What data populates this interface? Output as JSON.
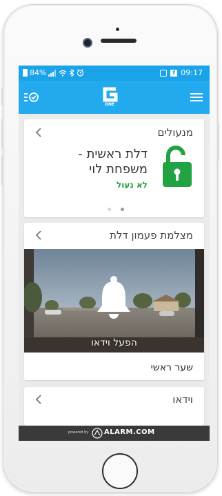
{
  "status_bar": {
    "battery": "84%",
    "time": "09:17",
    "fb_glyph": "f"
  },
  "app_bar": {
    "logo_text": "ONE",
    "left_icon": "check-list-icon",
    "right_icon": "hamburger-menu-icon"
  },
  "locks_card": {
    "title": "מנעולים",
    "lock_name_line1": "דלת ראשית -",
    "lock_name_line2": "משפחת לוי",
    "lock_status": "לא נעול",
    "lock_icon_color": "#23a244",
    "status_color": "#1e9e3e"
  },
  "doorbell_card": {
    "title": "מצלמת פעמון דלת",
    "play_label": "הפעל וידאו",
    "camera_name": "שער ראשי"
  },
  "video_card": {
    "title": "וידאו"
  },
  "footer": {
    "powered_by": "powered by",
    "brand": "ALARM.COM"
  },
  "colors": {
    "status_bar": "#1aa3e8",
    "app_bar": "#23a9ee",
    "footer": "#3a3a3a"
  }
}
